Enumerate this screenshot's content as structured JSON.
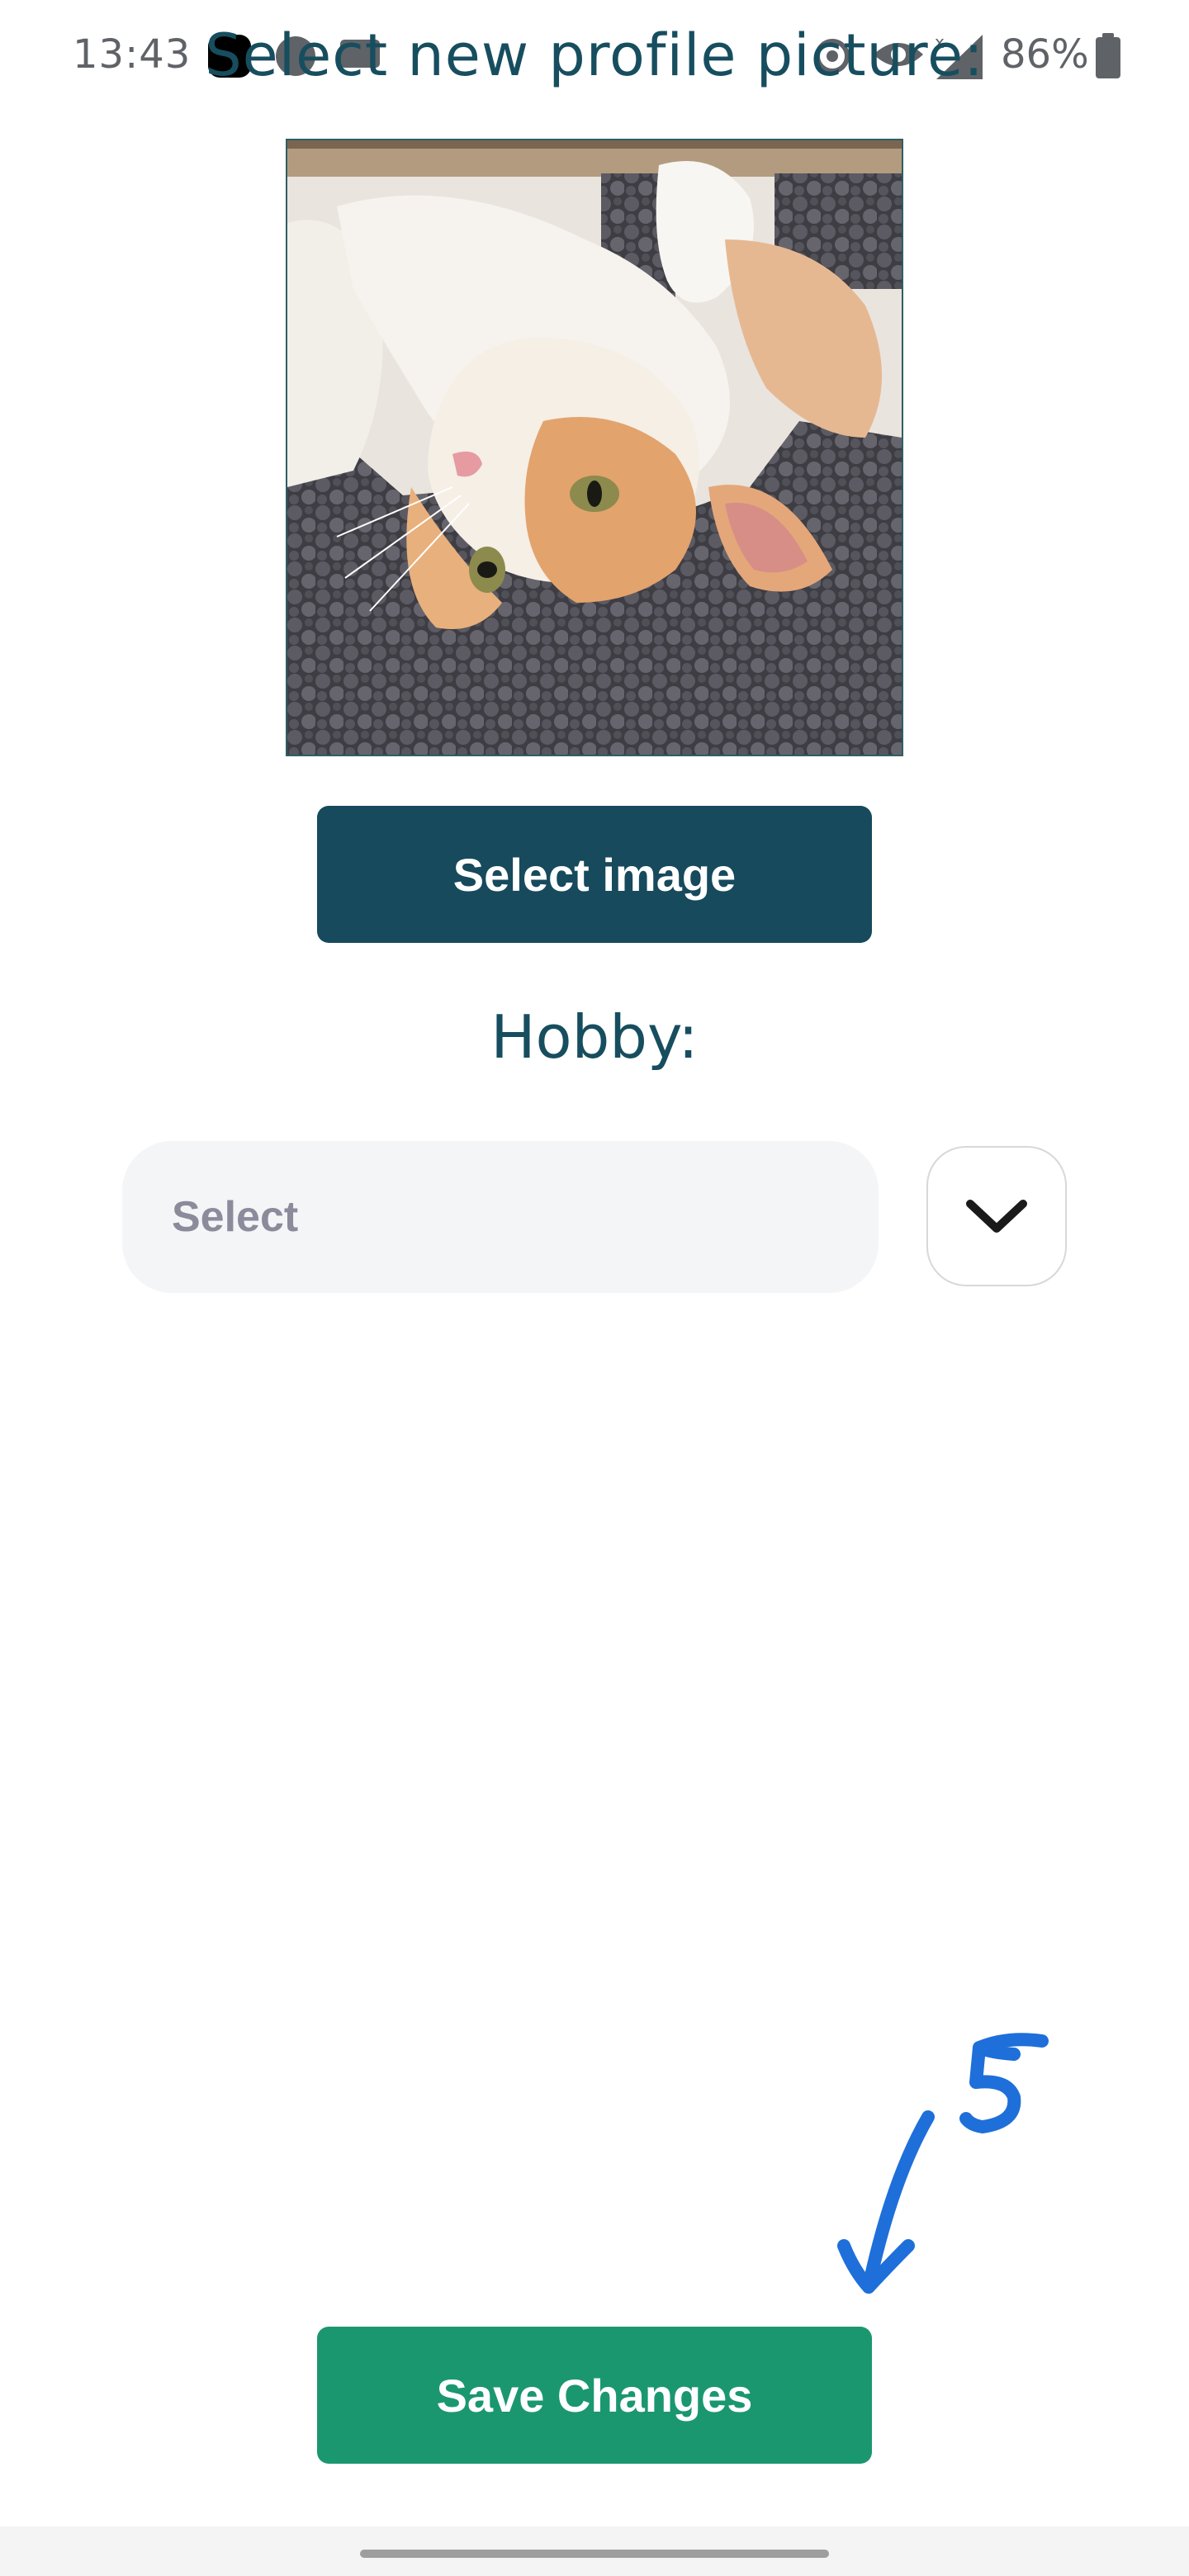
{
  "status_bar": {
    "time": "13:43",
    "battery": "86%",
    "icons": [
      "notification-square-icon",
      "notification-circle-icon",
      "message-icon",
      "sync-icon",
      "eye-icon",
      "signal-icon",
      "battery-icon"
    ]
  },
  "page": {
    "title": "Select new profile picture:"
  },
  "profile_image": {
    "subject": "calico-cat-photo"
  },
  "buttons": {
    "select_image": "Select image",
    "save_changes": "Save Changes"
  },
  "hobby": {
    "label": "Hobby:",
    "select_placeholder": "Select"
  },
  "annotation": {
    "number": "5",
    "color": "#1e6fd9"
  },
  "colors": {
    "primary_dark": "#164a5c",
    "title_text": "#174e5f",
    "save_green": "#1b9770"
  }
}
